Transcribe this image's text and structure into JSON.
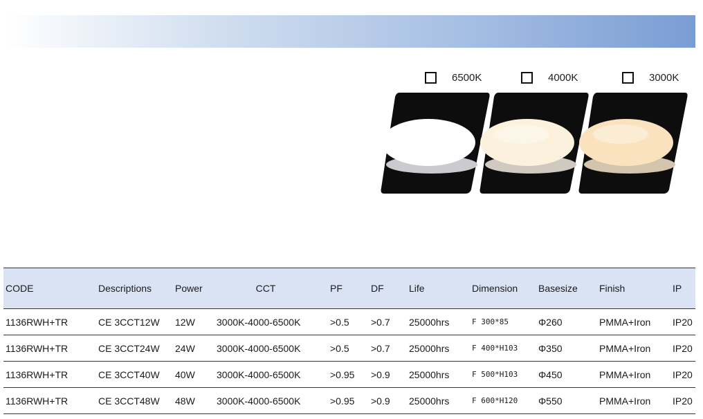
{
  "cct_options": [
    "6500K",
    "4000K",
    "3000K"
  ],
  "lamp_colors": [
    "#ffffff",
    "#fbf1dc",
    "#f9e2bd"
  ],
  "table": {
    "headers": [
      "CODE",
      "Descriptions",
      "Power",
      "CCT",
      "PF",
      "DF",
      "Life",
      "Dimension",
      "Basesize",
      "Finish",
      "IP"
    ],
    "rows": [
      [
        "1136RWH+TR",
        "CE 3CCT12W",
        "12W",
        "3000K-4000-6500K",
        ">0.5",
        ">0.7",
        "25000hrs",
        "F 300*85",
        "Φ260",
        "PMMA+Iron",
        "IP20"
      ],
      [
        "1136RWH+TR",
        "CE 3CCT24W",
        "24W",
        "3000K-4000-6500K",
        ">0.5",
        ">0.7",
        "25000hrs",
        "F 400*H103",
        "Φ350",
        "PMMA+Iron",
        "IP20"
      ],
      [
        "1136RWH+TR",
        "CE 3CCT40W",
        "40W",
        "3000K-4000-6500K",
        ">0.95",
        ">0.9",
        "25000hrs",
        "F 500*H103",
        "Φ450",
        "PMMA+Iron",
        "IP20"
      ],
      [
        "1136RWH+TR",
        "CE 3CCT48W",
        "48W",
        "3000K-4000-6500K",
        ">0.95",
        ">0.9",
        "25000hrs",
        "F 600*H120",
        "Φ550",
        "PMMA+Iron",
        "IP20"
      ]
    ]
  }
}
